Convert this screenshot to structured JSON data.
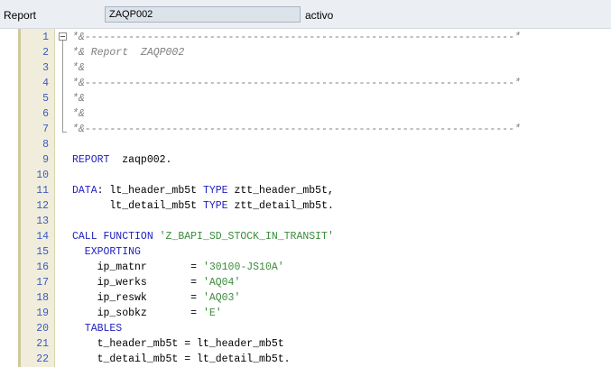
{
  "header": {
    "report_label": "Report",
    "program_value": "ZAQP002",
    "status_text": "activo"
  },
  "editor": {
    "lines": [
      {
        "no": "1",
        "tokens": [
          {
            "t": "*&---------------------------------------------------------------------*",
            "c": "comment"
          }
        ]
      },
      {
        "no": "2",
        "tokens": [
          {
            "t": "*& Report  ZAQP002",
            "c": "comment"
          }
        ]
      },
      {
        "no": "3",
        "tokens": [
          {
            "t": "*&",
            "c": "comment"
          }
        ]
      },
      {
        "no": "4",
        "tokens": [
          {
            "t": "*&---------------------------------------------------------------------*",
            "c": "comment"
          }
        ]
      },
      {
        "no": "5",
        "tokens": [
          {
            "t": "*&",
            "c": "comment"
          }
        ]
      },
      {
        "no": "6",
        "tokens": [
          {
            "t": "*&",
            "c": "comment"
          }
        ]
      },
      {
        "no": "7",
        "tokens": [
          {
            "t": "*&---------------------------------------------------------------------*",
            "c": "comment"
          }
        ]
      },
      {
        "no": "8",
        "tokens": []
      },
      {
        "no": "9",
        "tokens": [
          {
            "t": "REPORT",
            "c": "kw"
          },
          {
            "t": "  zaqp002.",
            "c": "id"
          }
        ]
      },
      {
        "no": "10",
        "tokens": []
      },
      {
        "no": "11",
        "tokens": [
          {
            "t": "DATA",
            "c": "kw"
          },
          {
            "t": ": lt_header_mb5t ",
            "c": "id"
          },
          {
            "t": "TYPE",
            "c": "kw"
          },
          {
            "t": " ztt_header_mb5t,",
            "c": "id"
          }
        ]
      },
      {
        "no": "12",
        "tokens": [
          {
            "t": "      lt_detail_mb5t ",
            "c": "id"
          },
          {
            "t": "TYPE",
            "c": "kw"
          },
          {
            "t": " ztt_detail_mb5t.",
            "c": "id"
          }
        ]
      },
      {
        "no": "13",
        "tokens": []
      },
      {
        "no": "14",
        "tokens": [
          {
            "t": "CALL FUNCTION ",
            "c": "kw"
          },
          {
            "t": "'Z_BAPI_SD_STOCK_IN_TRANSIT'",
            "c": "str"
          }
        ]
      },
      {
        "no": "15",
        "tokens": [
          {
            "t": "  EXPORTING",
            "c": "kw"
          }
        ]
      },
      {
        "no": "16",
        "tokens": [
          {
            "t": "    ip_matnr       = ",
            "c": "id"
          },
          {
            "t": "'30100-JS10A'",
            "c": "str"
          }
        ]
      },
      {
        "no": "17",
        "tokens": [
          {
            "t": "    ip_werks       = ",
            "c": "id"
          },
          {
            "t": "'AQ04'",
            "c": "str"
          }
        ]
      },
      {
        "no": "18",
        "tokens": [
          {
            "t": "    ip_reswk       = ",
            "c": "id"
          },
          {
            "t": "'AQ03'",
            "c": "str"
          }
        ]
      },
      {
        "no": "19",
        "tokens": [
          {
            "t": "    ip_sobkz       = ",
            "c": "id"
          },
          {
            "t": "'E'",
            "c": "str"
          }
        ]
      },
      {
        "no": "20",
        "tokens": [
          {
            "t": "  TABLES",
            "c": "kw"
          }
        ]
      },
      {
        "no": "21",
        "tokens": [
          {
            "t": "    t_header_mb5t = lt_header_mb5t",
            "c": "id"
          }
        ]
      },
      {
        "no": "22",
        "tokens": [
          {
            "t": "    t_detail_mb5t = lt_detail_mb5t.",
            "c": "id"
          }
        ]
      }
    ]
  },
  "colors": {
    "keyword": "#1f1fbf",
    "string": "#3c8c3c",
    "comment": "#7f7f7f",
    "line_number": "#3b5bbf"
  }
}
